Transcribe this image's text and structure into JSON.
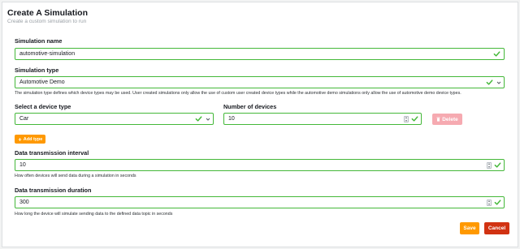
{
  "header": {
    "title": "Create A Simulation",
    "subtitle": "Create a custom simulation to run"
  },
  "simulation_name": {
    "label": "Simulation name",
    "value": "automotive-simulation"
  },
  "simulation_type": {
    "label": "Simulation type",
    "value": "Automotive Demo",
    "help": "The simulation type defines which device types may be used. User created simulations only allow the use of custom user created device types while the automotive demo simulations only allow the use of automotive demo device types."
  },
  "device_type": {
    "label": "Select a device type",
    "value": "Car"
  },
  "number_of_devices": {
    "label": "Number of devices",
    "value": "10"
  },
  "buttons": {
    "delete": "Delete",
    "add_type": "Add type",
    "save": "Save",
    "cancel": "Cancel"
  },
  "interval": {
    "label": "Data transmission interval",
    "value": "10",
    "help": "How often devices will send data during a simulation in seconds"
  },
  "duration": {
    "label": "Data transmission duration",
    "value": "300",
    "help": "How long the device will simulate sending data to the defined data topic in seconds"
  },
  "colors": {
    "valid_border": "#44b839",
    "primary": "#ff9900",
    "danger": "#d13212",
    "disabled_danger": "#f6aab1"
  }
}
